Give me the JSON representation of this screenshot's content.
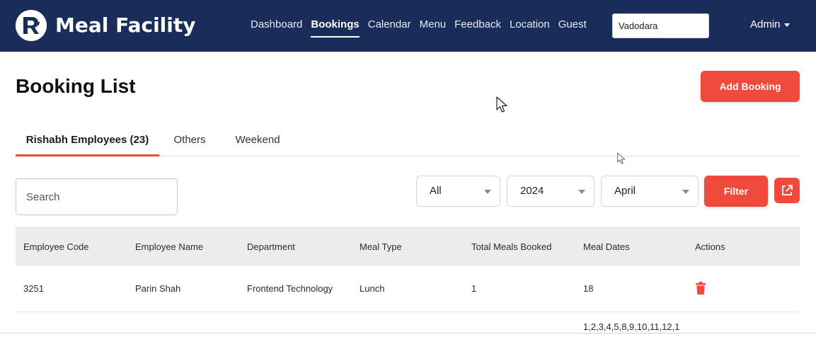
{
  "navbar": {
    "brand_name": "Meal Facility",
    "brand_logo_icon": "rishabh-r-logo-icon",
    "links": [
      {
        "label": "Dashboard",
        "active": false
      },
      {
        "label": "Bookings",
        "active": true
      },
      {
        "label": "Calendar",
        "active": false
      },
      {
        "label": "Menu",
        "active": false
      },
      {
        "label": "Feedback",
        "active": false
      },
      {
        "label": "Location",
        "active": false
      },
      {
        "label": "Guest",
        "active": false
      }
    ],
    "location_value": "Vadodara",
    "admin_label": "Admin",
    "colors": {
      "background": "#1a2d5a",
      "text": "#ffffff"
    }
  },
  "page": {
    "title": "Booking List",
    "add_booking_label": "Add Booking",
    "accent_color": "#ef4a3b"
  },
  "tabs": [
    {
      "label": "Rishabh Employees (23)",
      "active": true
    },
    {
      "label": "Others",
      "active": false
    },
    {
      "label": "Weekend",
      "active": false
    }
  ],
  "filters": {
    "search_placeholder": "Search",
    "type_selected": "All",
    "year_selected": "2024",
    "month_selected": "April",
    "filter_label": "Filter",
    "export_icon": "external-link-icon"
  },
  "table": {
    "headers": [
      "Employee Code",
      "Employee Name",
      "Department",
      "Meal Type",
      "Total Meals Booked",
      "Meal Dates",
      "Actions"
    ],
    "rows": [
      {
        "employee_code": "3251",
        "employee_name": "Parin Shah",
        "department": "Frontend Technology",
        "meal_type": "Lunch",
        "total_meals": "1",
        "meal_dates": "18",
        "action_icon": "trash-icon"
      },
      {
        "employee_code": "",
        "employee_name": "",
        "department": "",
        "meal_type": "",
        "total_meals": "",
        "meal_dates": "1,2,3,4,5,8,9,10,11,12,1",
        "action_icon": "trash-icon"
      }
    ]
  }
}
